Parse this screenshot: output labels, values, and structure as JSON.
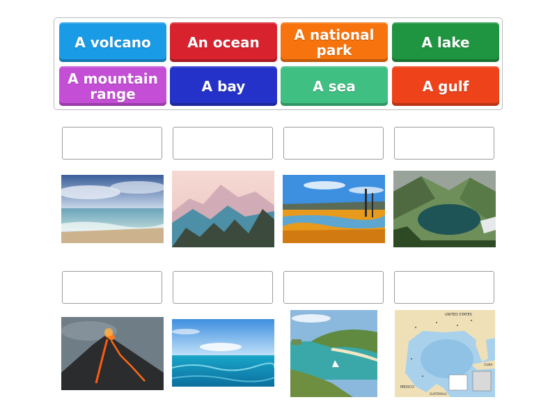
{
  "tiles": [
    {
      "label": "A volcano",
      "color": "#1a9be6"
    },
    {
      "label": "An ocean",
      "color": "#d8232f"
    },
    {
      "label": "A national park",
      "color": "#f7730d"
    },
    {
      "label": "A lake",
      "color": "#1f9441"
    },
    {
      "label": "A mountain range",
      "color": "#c44ed6"
    },
    {
      "label": "A bay",
      "color": "#2432c9"
    },
    {
      "label": "A sea",
      "color": "#3fbf81"
    },
    {
      "label": "A gulf",
      "color": "#ee421a"
    }
  ],
  "images": [
    {
      "subject": "sea-shore-photo"
    },
    {
      "subject": "mountain-range-photo"
    },
    {
      "subject": "national-park-hot-spring-photo"
    },
    {
      "subject": "mountain-lake-photo"
    },
    {
      "subject": "erupting-volcano-photo"
    },
    {
      "subject": "ocean-water-photo"
    },
    {
      "subject": "bay-beach-photo"
    },
    {
      "subject": "gulf-of-mexico-map"
    }
  ],
  "map_labels": {
    "country_top": "UNITED STATES",
    "country_bottom": "MEXICO",
    "country_right": "CUBA",
    "country_bottom2": "GUATEMALA"
  }
}
